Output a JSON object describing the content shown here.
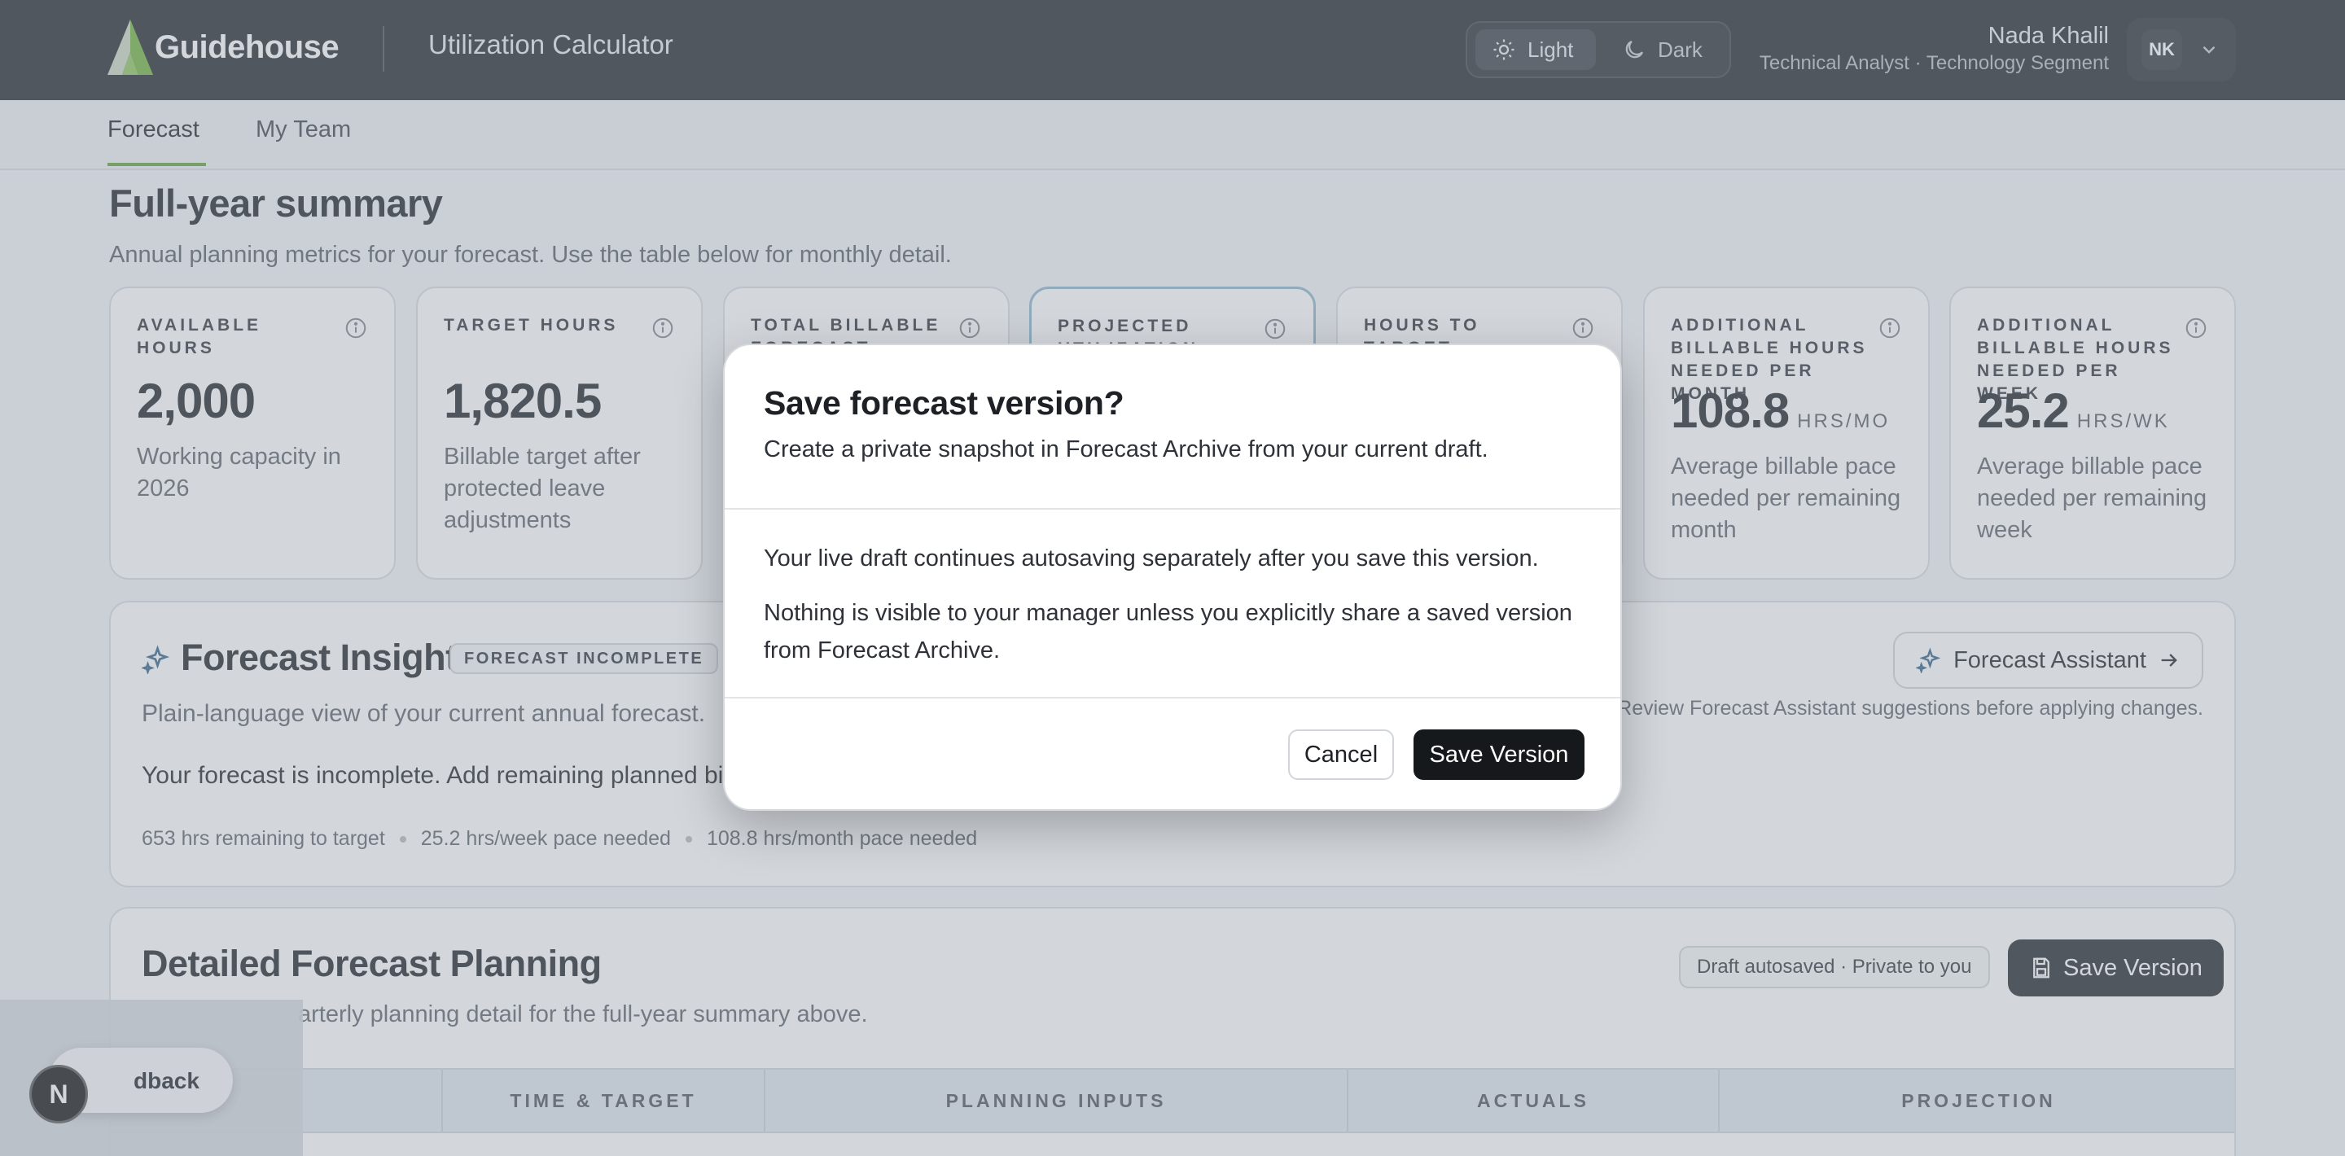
{
  "header": {
    "logo_text": "Guidehouse",
    "app_title": "Utilization Calculator",
    "theme": {
      "light_label": "Light",
      "dark_label": "Dark",
      "selected": "Light"
    },
    "user": {
      "name": "Nada Khalil",
      "role": "Technical Analyst · Technology Segment",
      "initials": "NK"
    }
  },
  "tabs": [
    {
      "label": "Forecast",
      "active": true
    },
    {
      "label": "My Team",
      "active": false
    }
  ],
  "summary": {
    "title": "Full-year summary",
    "subtitle": "Annual planning metrics for your forecast. Use the table below for monthly detail.",
    "kpis": [
      {
        "label": "AVAILABLE HOURS",
        "value": "2,000",
        "unit": "",
        "desc": "Working capacity in 2026"
      },
      {
        "label": "TARGET HOURS",
        "value": "1,820.5",
        "unit": "",
        "desc": "Billable target after protected leave adjustments"
      },
      {
        "label": "TOTAL BILLABLE FORECAST",
        "value": "",
        "unit": "",
        "desc": ""
      },
      {
        "label": "PROJECTED UTILIZATION",
        "value": "",
        "unit": "",
        "desc": ""
      },
      {
        "label": "HOURS TO TARGET",
        "value": "",
        "unit": "",
        "desc": ""
      },
      {
        "label": "ADDITIONAL BILLABLE HOURS NEEDED PER MONTH",
        "value": "108.8",
        "unit": "HRS/MO",
        "desc": "Average billable pace needed per remaining month"
      },
      {
        "label": "ADDITIONAL BILLABLE HOURS NEEDED PER WEEK",
        "value": "25.2",
        "unit": "HRS/WK",
        "desc": "Average billable pace needed per remaining week"
      }
    ]
  },
  "insight": {
    "title": "Forecast Insight",
    "badge": "FORECAST INCOMPLETE",
    "subtitle": "Plain-language view of your current annual forecast.",
    "text": "Your forecast is incomplete. Add remaining planned billa",
    "stats": [
      "653 hrs remaining to target",
      "25.2 hrs/week pace needed",
      "108.8 hrs/month pace needed"
    ],
    "assistant_button": "Forecast Assistant",
    "assistant_note": "Review Forecast Assistant suggestions before applying changes."
  },
  "detail": {
    "title": "Detailed Forecast Planning",
    "subtitle": "arterly planning detail for the full-year summary above.",
    "draft_status": "Draft autosaved · Private to you",
    "save_button": "Save Version",
    "columns": [
      "TIME & TARGET",
      "PLANNING INPUTS",
      "ACTUALS",
      "PROJECTION"
    ]
  },
  "feedback": {
    "label": "dback",
    "logo": "N"
  },
  "dialog": {
    "title": "Save forecast version?",
    "subtitle": "Create a private snapshot in Forecast Archive from your current draft.",
    "p1": "Your live draft continues autosaving separately after you save this version.",
    "p2": "Nothing is visible to your manager unless you explicitly share a saved version from Forecast Archive.",
    "cancel": "Cancel",
    "confirm": "Save Version"
  },
  "colors": {
    "accent": "#5fa135",
    "topbar": "#1f2327",
    "overlay": "rgba(150,160,172,0.42)"
  }
}
